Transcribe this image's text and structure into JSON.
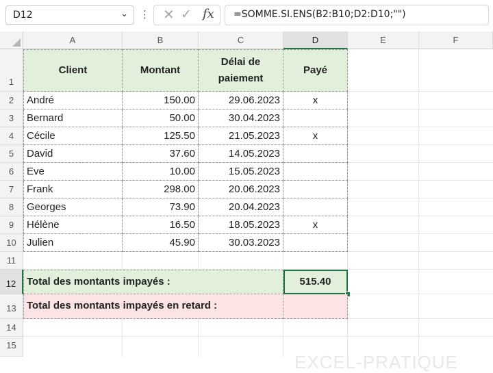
{
  "formula_bar": {
    "name_box": "D12",
    "cancel_icon": "close-icon",
    "enter_icon": "check-icon",
    "function_label": "fx",
    "formula": "=SOMME.SI.ENS(B2:B10;D2:D10;\"\")"
  },
  "columns": [
    "A",
    "B",
    "C",
    "D",
    "E",
    "F"
  ],
  "rows": [
    "1",
    "2",
    "3",
    "4",
    "5",
    "6",
    "7",
    "8",
    "9",
    "10",
    "11",
    "12",
    "13",
    "14",
    "15"
  ],
  "table": {
    "headers": {
      "client": "Client",
      "montant": "Montant",
      "delai": "Délai de paiement",
      "paye": "Payé"
    },
    "records": [
      {
        "client": "André",
        "montant": "150.00",
        "delai": "29.06.2023",
        "paye": "x"
      },
      {
        "client": "Bernard",
        "montant": "50.00",
        "delai": "30.04.2023",
        "paye": ""
      },
      {
        "client": "Cécile",
        "montant": "125.50",
        "delai": "21.05.2023",
        "paye": "x"
      },
      {
        "client": "David",
        "montant": "37.60",
        "delai": "14.05.2023",
        "paye": ""
      },
      {
        "client": "Eve",
        "montant": "10.00",
        "delai": "15.05.2023",
        "paye": ""
      },
      {
        "client": "Frank",
        "montant": "298.00",
        "delai": "20.06.2023",
        "paye": ""
      },
      {
        "client": "Georges",
        "montant": "73.90",
        "delai": "20.04.2023",
        "paye": ""
      },
      {
        "client": "Hélène",
        "montant": "16.50",
        "delai": "18.05.2023",
        "paye": "x"
      },
      {
        "client": "Julien",
        "montant": "45.90",
        "delai": "30.03.2023",
        "paye": ""
      }
    ]
  },
  "totals": {
    "unpaid_label": "Total des montants impayés :",
    "unpaid_value": "515.40",
    "late_label": "Total des montants impayés en retard :",
    "late_value": ""
  },
  "colors": {
    "header_fill": "#e2efda",
    "late_fill": "#fce4e4",
    "selection": "#217346"
  },
  "watermark": "EXCEL-PRATIQUE"
}
